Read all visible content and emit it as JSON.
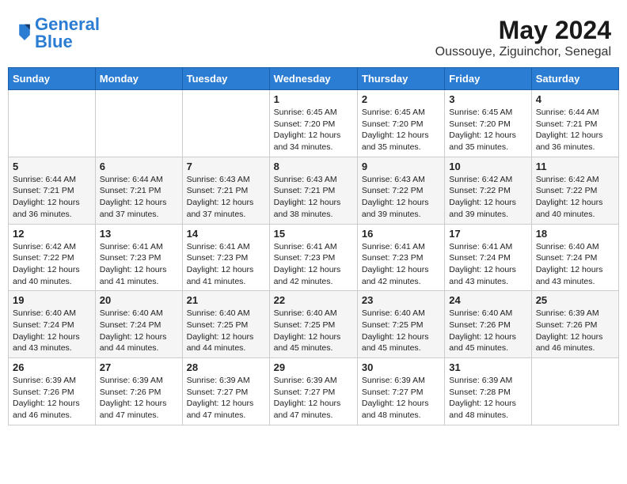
{
  "header": {
    "logo_general": "General",
    "logo_blue": "Blue",
    "month_title": "May 2024",
    "location": "Oussouye, Ziguinchor, Senegal"
  },
  "days_of_week": [
    "Sunday",
    "Monday",
    "Tuesday",
    "Wednesday",
    "Thursday",
    "Friday",
    "Saturday"
  ],
  "weeks": [
    {
      "row_class": "row-1",
      "days": [
        {
          "num": "",
          "info": "",
          "empty": true
        },
        {
          "num": "",
          "info": "",
          "empty": true
        },
        {
          "num": "",
          "info": "",
          "empty": true
        },
        {
          "num": "1",
          "info": "Sunrise: 6:45 AM\nSunset: 7:20 PM\nDaylight: 12 hours\nand 34 minutes.",
          "empty": false
        },
        {
          "num": "2",
          "info": "Sunrise: 6:45 AM\nSunset: 7:20 PM\nDaylight: 12 hours\nand 35 minutes.",
          "empty": false
        },
        {
          "num": "3",
          "info": "Sunrise: 6:45 AM\nSunset: 7:20 PM\nDaylight: 12 hours\nand 35 minutes.",
          "empty": false
        },
        {
          "num": "4",
          "info": "Sunrise: 6:44 AM\nSunset: 7:21 PM\nDaylight: 12 hours\nand 36 minutes.",
          "empty": false
        }
      ]
    },
    {
      "row_class": "row-2",
      "days": [
        {
          "num": "5",
          "info": "Sunrise: 6:44 AM\nSunset: 7:21 PM\nDaylight: 12 hours\nand 36 minutes.",
          "empty": false
        },
        {
          "num": "6",
          "info": "Sunrise: 6:44 AM\nSunset: 7:21 PM\nDaylight: 12 hours\nand 37 minutes.",
          "empty": false
        },
        {
          "num": "7",
          "info": "Sunrise: 6:43 AM\nSunset: 7:21 PM\nDaylight: 12 hours\nand 37 minutes.",
          "empty": false
        },
        {
          "num": "8",
          "info": "Sunrise: 6:43 AM\nSunset: 7:21 PM\nDaylight: 12 hours\nand 38 minutes.",
          "empty": false
        },
        {
          "num": "9",
          "info": "Sunrise: 6:43 AM\nSunset: 7:22 PM\nDaylight: 12 hours\nand 39 minutes.",
          "empty": false
        },
        {
          "num": "10",
          "info": "Sunrise: 6:42 AM\nSunset: 7:22 PM\nDaylight: 12 hours\nand 39 minutes.",
          "empty": false
        },
        {
          "num": "11",
          "info": "Sunrise: 6:42 AM\nSunset: 7:22 PM\nDaylight: 12 hours\nand 40 minutes.",
          "empty": false
        }
      ]
    },
    {
      "row_class": "row-3",
      "days": [
        {
          "num": "12",
          "info": "Sunrise: 6:42 AM\nSunset: 7:22 PM\nDaylight: 12 hours\nand 40 minutes.",
          "empty": false
        },
        {
          "num": "13",
          "info": "Sunrise: 6:41 AM\nSunset: 7:23 PM\nDaylight: 12 hours\nand 41 minutes.",
          "empty": false
        },
        {
          "num": "14",
          "info": "Sunrise: 6:41 AM\nSunset: 7:23 PM\nDaylight: 12 hours\nand 41 minutes.",
          "empty": false
        },
        {
          "num": "15",
          "info": "Sunrise: 6:41 AM\nSunset: 7:23 PM\nDaylight: 12 hours\nand 42 minutes.",
          "empty": false
        },
        {
          "num": "16",
          "info": "Sunrise: 6:41 AM\nSunset: 7:23 PM\nDaylight: 12 hours\nand 42 minutes.",
          "empty": false
        },
        {
          "num": "17",
          "info": "Sunrise: 6:41 AM\nSunset: 7:24 PM\nDaylight: 12 hours\nand 43 minutes.",
          "empty": false
        },
        {
          "num": "18",
          "info": "Sunrise: 6:40 AM\nSunset: 7:24 PM\nDaylight: 12 hours\nand 43 minutes.",
          "empty": false
        }
      ]
    },
    {
      "row_class": "row-4",
      "days": [
        {
          "num": "19",
          "info": "Sunrise: 6:40 AM\nSunset: 7:24 PM\nDaylight: 12 hours\nand 43 minutes.",
          "empty": false
        },
        {
          "num": "20",
          "info": "Sunrise: 6:40 AM\nSunset: 7:24 PM\nDaylight: 12 hours\nand 44 minutes.",
          "empty": false
        },
        {
          "num": "21",
          "info": "Sunrise: 6:40 AM\nSunset: 7:25 PM\nDaylight: 12 hours\nand 44 minutes.",
          "empty": false
        },
        {
          "num": "22",
          "info": "Sunrise: 6:40 AM\nSunset: 7:25 PM\nDaylight: 12 hours\nand 45 minutes.",
          "empty": false
        },
        {
          "num": "23",
          "info": "Sunrise: 6:40 AM\nSunset: 7:25 PM\nDaylight: 12 hours\nand 45 minutes.",
          "empty": false
        },
        {
          "num": "24",
          "info": "Sunrise: 6:40 AM\nSunset: 7:26 PM\nDaylight: 12 hours\nand 45 minutes.",
          "empty": false
        },
        {
          "num": "25",
          "info": "Sunrise: 6:39 AM\nSunset: 7:26 PM\nDaylight: 12 hours\nand 46 minutes.",
          "empty": false
        }
      ]
    },
    {
      "row_class": "row-5",
      "days": [
        {
          "num": "26",
          "info": "Sunrise: 6:39 AM\nSunset: 7:26 PM\nDaylight: 12 hours\nand 46 minutes.",
          "empty": false
        },
        {
          "num": "27",
          "info": "Sunrise: 6:39 AM\nSunset: 7:26 PM\nDaylight: 12 hours\nand 47 minutes.",
          "empty": false
        },
        {
          "num": "28",
          "info": "Sunrise: 6:39 AM\nSunset: 7:27 PM\nDaylight: 12 hours\nand 47 minutes.",
          "empty": false
        },
        {
          "num": "29",
          "info": "Sunrise: 6:39 AM\nSunset: 7:27 PM\nDaylight: 12 hours\nand 47 minutes.",
          "empty": false
        },
        {
          "num": "30",
          "info": "Sunrise: 6:39 AM\nSunset: 7:27 PM\nDaylight: 12 hours\nand 48 minutes.",
          "empty": false
        },
        {
          "num": "31",
          "info": "Sunrise: 6:39 AM\nSunset: 7:28 PM\nDaylight: 12 hours\nand 48 minutes.",
          "empty": false
        },
        {
          "num": "",
          "info": "",
          "empty": true
        }
      ]
    }
  ]
}
